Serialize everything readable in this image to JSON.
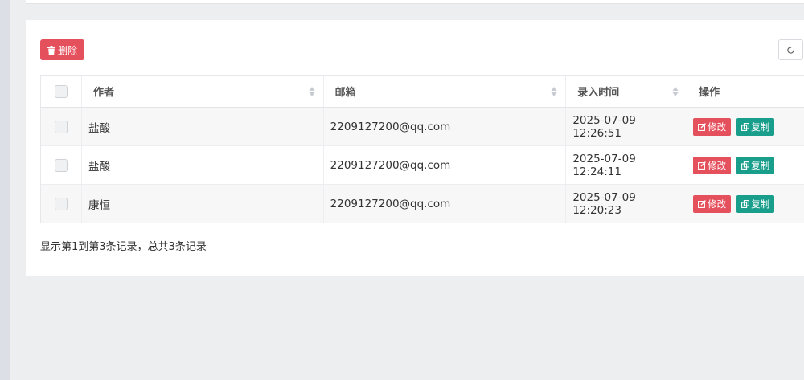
{
  "toolbar": {
    "delete_label": "删除"
  },
  "table": {
    "columns": [
      "作者",
      "邮箱",
      "录入时间",
      "操作"
    ],
    "rows": [
      {
        "author": "盐酸",
        "email": "2209127200@qq.com",
        "time": "2025-07-09 12:26:51"
      },
      {
        "author": "盐酸",
        "email": "2209127200@qq.com",
        "time": "2025-07-09 12:24:11"
      },
      {
        "author": "康恒",
        "email": "2209127200@qq.com",
        "time": "2025-07-09 12:20:23"
      }
    ],
    "edit_label": "修改",
    "copy_label": "复制"
  },
  "pagination": {
    "summary": "显示第1到第3条记录，总共3条记录"
  },
  "colors": {
    "danger": "#e5505d",
    "teal": "#1a9e8c"
  }
}
